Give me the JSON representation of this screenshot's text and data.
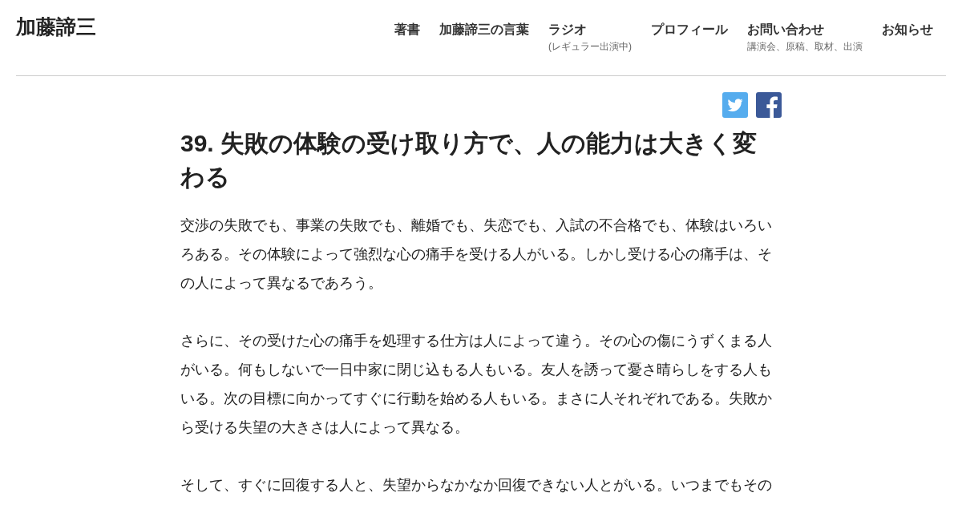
{
  "site_title": "加藤諦三",
  "nav": [
    {
      "label": "著書"
    },
    {
      "label": "加藤諦三の言葉"
    },
    {
      "label": "ラジオ",
      "sublabel": "(レギュラー出演中)"
    },
    {
      "label": "プロフィール"
    },
    {
      "label": "お問い合わせ",
      "sublabel": "講演会、原稿、取材、出演"
    },
    {
      "label": "お知らせ"
    }
  ],
  "share_buttons": [
    {
      "kind": "twitter"
    },
    {
      "kind": "facebook"
    }
  ],
  "article": {
    "title": "39. 失敗の体験の受け取り方で、人の能力は大きく変わる",
    "paragraphs": [
      "交渉の失敗でも、事業の失敗でも、離婚でも、失恋でも、入試の不合格でも、体験はいろいろある。その体験によって強烈な心の痛手を受ける人がいる。しかし受ける心の痛手は、その人によって異なるであろう。",
      "さらに、その受けた心の痛手を処理する仕方は人によって違う。その心の傷にうずくまる人がいる。何もしないで一日中家に閉じ込もる人もいる。友人を誘って憂さ晴らしをする人もいる。次の目標に向かってすぐに行動を始める人もいる。まさに人それぞれである。失敗から受ける失望の大きさは人によって異なる。",
      "そして、すぐに回復する人と、失望からなかなか回復できない人とがいる。いつまでもその"
    ]
  }
}
